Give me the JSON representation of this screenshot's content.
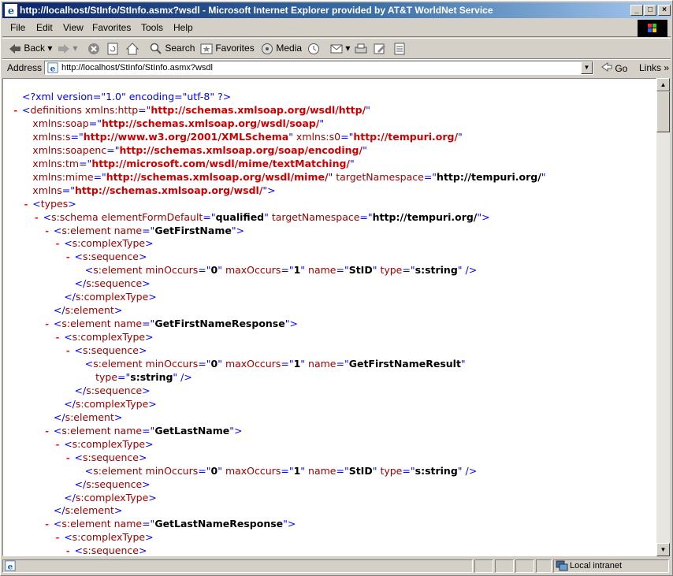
{
  "window": {
    "title": "http://localhost/StInfo/StInfo.asmx?wsdl - Microsoft Internet Explorer provided by AT&T WorldNet Service",
    "minimize_label": "_",
    "maximize_label": "□",
    "close_label": "×"
  },
  "menu": [
    "File",
    "Edit",
    "View",
    "Favorites",
    "Tools",
    "Help"
  ],
  "toolbar": {
    "back": "Back",
    "search": "Search",
    "favorites": "Favorites",
    "media": "Media"
  },
  "address": {
    "label": "Address",
    "value": "http://localhost/StInfo/StInfo.asmx?wsdl",
    "go": "Go",
    "links": "Links"
  },
  "status": {
    "zone": "Local intranet"
  },
  "xml_lines": [
    {
      "indent": 0,
      "minus": "",
      "parts": [
        [
          "pi",
          "<?xml version=\"1.0\" encoding=\"utf-8\" ?>"
        ]
      ]
    },
    {
      "indent": 0,
      "minus": "-",
      "parts": [
        [
          "b",
          "<"
        ],
        [
          "t",
          "definitions "
        ],
        [
          "an",
          "xmlns:http"
        ],
        [
          "b",
          "=\""
        ],
        [
          "avr",
          "http://schemas.xmlsoap.org/wsdl/http/"
        ],
        [
          "b",
          "\""
        ]
      ]
    },
    {
      "indent": 1,
      "minus": "",
      "parts": [
        [
          "an",
          "xmlns:soap"
        ],
        [
          "b",
          "=\""
        ],
        [
          "avr",
          "http://schemas.xmlsoap.org/wsdl/soap/"
        ],
        [
          "b",
          "\""
        ]
      ]
    },
    {
      "indent": 1,
      "minus": "",
      "parts": [
        [
          "an",
          "xmlns:s"
        ],
        [
          "b",
          "=\""
        ],
        [
          "avr",
          "http://www.w3.org/2001/XMLSchema"
        ],
        [
          "b",
          "\" "
        ],
        [
          "an",
          "xmlns:s0"
        ],
        [
          "b",
          "=\""
        ],
        [
          "avr",
          "http://tempuri.org/"
        ],
        [
          "b",
          "\""
        ]
      ]
    },
    {
      "indent": 1,
      "minus": "",
      "parts": [
        [
          "an",
          "xmlns:soapenc"
        ],
        [
          "b",
          "=\""
        ],
        [
          "avr",
          "http://schemas.xmlsoap.org/soap/encoding/"
        ],
        [
          "b",
          "\""
        ]
      ]
    },
    {
      "indent": 1,
      "minus": "",
      "parts": [
        [
          "an",
          "xmlns:tm"
        ],
        [
          "b",
          "=\""
        ],
        [
          "avr",
          "http://microsoft.com/wsdl/mime/textMatching/"
        ],
        [
          "b",
          "\""
        ]
      ]
    },
    {
      "indent": 1,
      "minus": "",
      "parts": [
        [
          "an",
          "xmlns:mime"
        ],
        [
          "b",
          "=\""
        ],
        [
          "avr",
          "http://schemas.xmlsoap.org/wsdl/mime/"
        ],
        [
          "b",
          "\" "
        ],
        [
          "an",
          "targetNamespace"
        ],
        [
          "b",
          "=\""
        ],
        [
          "av",
          "http://tempuri.org/"
        ],
        [
          "b",
          "\""
        ]
      ]
    },
    {
      "indent": 1,
      "minus": "",
      "parts": [
        [
          "an",
          "xmlns"
        ],
        [
          "b",
          "=\""
        ],
        [
          "avr",
          "http://schemas.xmlsoap.org/wsdl/"
        ],
        [
          "b",
          "\">"
        ]
      ]
    },
    {
      "indent": 1,
      "minus": "-",
      "parts": [
        [
          "b",
          "<"
        ],
        [
          "t",
          "types"
        ],
        [
          "b",
          ">"
        ]
      ]
    },
    {
      "indent": 2,
      "minus": "-",
      "parts": [
        [
          "b",
          "<"
        ],
        [
          "t",
          "s:schema "
        ],
        [
          "an",
          "elementFormDefault"
        ],
        [
          "b",
          "=\""
        ],
        [
          "av",
          "qualified"
        ],
        [
          "b",
          "\" "
        ],
        [
          "an",
          "targetNamespace"
        ],
        [
          "b",
          "=\""
        ],
        [
          "av",
          "http://tempuri.org/"
        ],
        [
          "b",
          "\">"
        ]
      ]
    },
    {
      "indent": 3,
      "minus": "-",
      "parts": [
        [
          "b",
          "<"
        ],
        [
          "t",
          "s:element "
        ],
        [
          "an",
          "name"
        ],
        [
          "b",
          "=\""
        ],
        [
          "av",
          "GetFirstName"
        ],
        [
          "b",
          "\">"
        ]
      ]
    },
    {
      "indent": 4,
      "minus": "-",
      "parts": [
        [
          "b",
          "<"
        ],
        [
          "t",
          "s:complexType"
        ],
        [
          "b",
          ">"
        ]
      ]
    },
    {
      "indent": 5,
      "minus": "-",
      "parts": [
        [
          "b",
          "<"
        ],
        [
          "t",
          "s:sequence"
        ],
        [
          "b",
          ">"
        ]
      ]
    },
    {
      "indent": 6,
      "minus": "",
      "parts": [
        [
          "b",
          "<"
        ],
        [
          "t",
          "s:element "
        ],
        [
          "an",
          "minOccurs"
        ],
        [
          "b",
          "=\""
        ],
        [
          "av",
          "0"
        ],
        [
          "b",
          "\" "
        ],
        [
          "an",
          "maxOccurs"
        ],
        [
          "b",
          "=\""
        ],
        [
          "av",
          "1"
        ],
        [
          "b",
          "\" "
        ],
        [
          "an",
          "name"
        ],
        [
          "b",
          "=\""
        ],
        [
          "av",
          "StID"
        ],
        [
          "b",
          "\" "
        ],
        [
          "an",
          "type"
        ],
        [
          "b",
          "=\""
        ],
        [
          "av",
          "s:string"
        ],
        [
          "b",
          "\" />"
        ]
      ]
    },
    {
      "indent": 5,
      "minus": "",
      "parts": [
        [
          "b",
          "</"
        ],
        [
          "t",
          "s:sequence"
        ],
        [
          "b",
          ">"
        ]
      ]
    },
    {
      "indent": 4,
      "minus": "",
      "parts": [
        [
          "b",
          "</"
        ],
        [
          "t",
          "s:complexType"
        ],
        [
          "b",
          ">"
        ]
      ]
    },
    {
      "indent": 3,
      "minus": "",
      "parts": [
        [
          "b",
          "</"
        ],
        [
          "t",
          "s:element"
        ],
        [
          "b",
          ">"
        ]
      ]
    },
    {
      "indent": 3,
      "minus": "-",
      "parts": [
        [
          "b",
          "<"
        ],
        [
          "t",
          "s:element "
        ],
        [
          "an",
          "name"
        ],
        [
          "b",
          "=\""
        ],
        [
          "av",
          "GetFirstNameResponse"
        ],
        [
          "b",
          "\">"
        ]
      ]
    },
    {
      "indent": 4,
      "minus": "-",
      "parts": [
        [
          "b",
          "<"
        ],
        [
          "t",
          "s:complexType"
        ],
        [
          "b",
          ">"
        ]
      ]
    },
    {
      "indent": 5,
      "minus": "-",
      "parts": [
        [
          "b",
          "<"
        ],
        [
          "t",
          "s:sequence"
        ],
        [
          "b",
          ">"
        ]
      ]
    },
    {
      "indent": 6,
      "minus": "",
      "parts": [
        [
          "b",
          "<"
        ],
        [
          "t",
          "s:element "
        ],
        [
          "an",
          "minOccurs"
        ],
        [
          "b",
          "=\""
        ],
        [
          "av",
          "0"
        ],
        [
          "b",
          "\" "
        ],
        [
          "an",
          "maxOccurs"
        ],
        [
          "b",
          "=\""
        ],
        [
          "av",
          "1"
        ],
        [
          "b",
          "\" "
        ],
        [
          "an",
          "name"
        ],
        [
          "b",
          "=\""
        ],
        [
          "av",
          "GetFirstNameResult"
        ],
        [
          "b",
          "\""
        ]
      ]
    },
    {
      "indent": 7,
      "minus": "",
      "parts": [
        [
          "an",
          "type"
        ],
        [
          "b",
          "=\""
        ],
        [
          "av",
          "s:string"
        ],
        [
          "b",
          "\" />"
        ]
      ]
    },
    {
      "indent": 5,
      "minus": "",
      "parts": [
        [
          "b",
          "</"
        ],
        [
          "t",
          "s:sequence"
        ],
        [
          "b",
          ">"
        ]
      ]
    },
    {
      "indent": 4,
      "minus": "",
      "parts": [
        [
          "b",
          "</"
        ],
        [
          "t",
          "s:complexType"
        ],
        [
          "b",
          ">"
        ]
      ]
    },
    {
      "indent": 3,
      "minus": "",
      "parts": [
        [
          "b",
          "</"
        ],
        [
          "t",
          "s:element"
        ],
        [
          "b",
          ">"
        ]
      ]
    },
    {
      "indent": 3,
      "minus": "-",
      "parts": [
        [
          "b",
          "<"
        ],
        [
          "t",
          "s:element "
        ],
        [
          "an",
          "name"
        ],
        [
          "b",
          "=\""
        ],
        [
          "av",
          "GetLastName"
        ],
        [
          "b",
          "\">"
        ]
      ]
    },
    {
      "indent": 4,
      "minus": "-",
      "parts": [
        [
          "b",
          "<"
        ],
        [
          "t",
          "s:complexType"
        ],
        [
          "b",
          ">"
        ]
      ]
    },
    {
      "indent": 5,
      "minus": "-",
      "parts": [
        [
          "b",
          "<"
        ],
        [
          "t",
          "s:sequence"
        ],
        [
          "b",
          ">"
        ]
      ]
    },
    {
      "indent": 6,
      "minus": "",
      "parts": [
        [
          "b",
          "<"
        ],
        [
          "t",
          "s:element "
        ],
        [
          "an",
          "minOccurs"
        ],
        [
          "b",
          "=\""
        ],
        [
          "av",
          "0"
        ],
        [
          "b",
          "\" "
        ],
        [
          "an",
          "maxOccurs"
        ],
        [
          "b",
          "=\""
        ],
        [
          "av",
          "1"
        ],
        [
          "b",
          "\" "
        ],
        [
          "an",
          "name"
        ],
        [
          "b",
          "=\""
        ],
        [
          "av",
          "StID"
        ],
        [
          "b",
          "\" "
        ],
        [
          "an",
          "type"
        ],
        [
          "b",
          "=\""
        ],
        [
          "av",
          "s:string"
        ],
        [
          "b",
          "\" />"
        ]
      ]
    },
    {
      "indent": 5,
      "minus": "",
      "parts": [
        [
          "b",
          "</"
        ],
        [
          "t",
          "s:sequence"
        ],
        [
          "b",
          ">"
        ]
      ]
    },
    {
      "indent": 4,
      "minus": "",
      "parts": [
        [
          "b",
          "</"
        ],
        [
          "t",
          "s:complexType"
        ],
        [
          "b",
          ">"
        ]
      ]
    },
    {
      "indent": 3,
      "minus": "",
      "parts": [
        [
          "b",
          "</"
        ],
        [
          "t",
          "s:element"
        ],
        [
          "b",
          ">"
        ]
      ]
    },
    {
      "indent": 3,
      "minus": "-",
      "parts": [
        [
          "b",
          "<"
        ],
        [
          "t",
          "s:element "
        ],
        [
          "an",
          "name"
        ],
        [
          "b",
          "=\""
        ],
        [
          "av",
          "GetLastNameResponse"
        ],
        [
          "b",
          "\">"
        ]
      ]
    },
    {
      "indent": 4,
      "minus": "-",
      "parts": [
        [
          "b",
          "<"
        ],
        [
          "t",
          "s:complexType"
        ],
        [
          "b",
          ">"
        ]
      ]
    },
    {
      "indent": 5,
      "minus": "-",
      "parts": [
        [
          "b",
          "<"
        ],
        [
          "t",
          "s:sequence"
        ],
        [
          "b",
          ">"
        ]
      ]
    }
  ]
}
